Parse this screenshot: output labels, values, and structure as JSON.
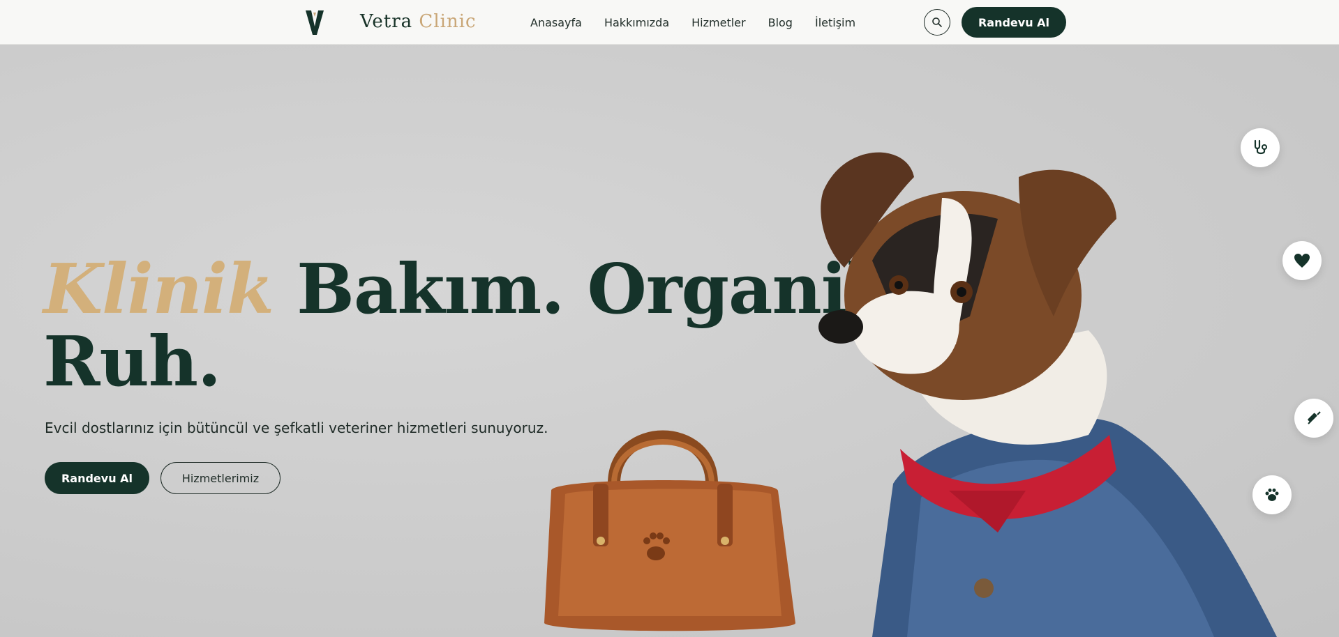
{
  "header": {
    "brand_primary": "Vetra",
    "brand_accent": "Clinic",
    "nav": [
      "Anasayfa",
      "Hakkımızda",
      "Hizmetler",
      "Blog",
      "İletişim"
    ],
    "cta": "Randevu Al"
  },
  "hero": {
    "headline_accent": "Klinik",
    "headline_line1": "Bakım. Organik",
    "headline_line2": "Ruh.",
    "subtitle": "Evcil dostlarınız için bütüncül ve şefkatli veteriner hizmetleri sunuyoruz.",
    "primary_button": "Randevu Al",
    "secondary_button": "Hizmetlerimiz"
  },
  "colors": {
    "primary_dark": "#15332a",
    "accent_gold": "#d3b07b"
  },
  "floating_icons": [
    "stethoscope-icon",
    "heart-icon",
    "syringe-icon",
    "paw-icon"
  ]
}
